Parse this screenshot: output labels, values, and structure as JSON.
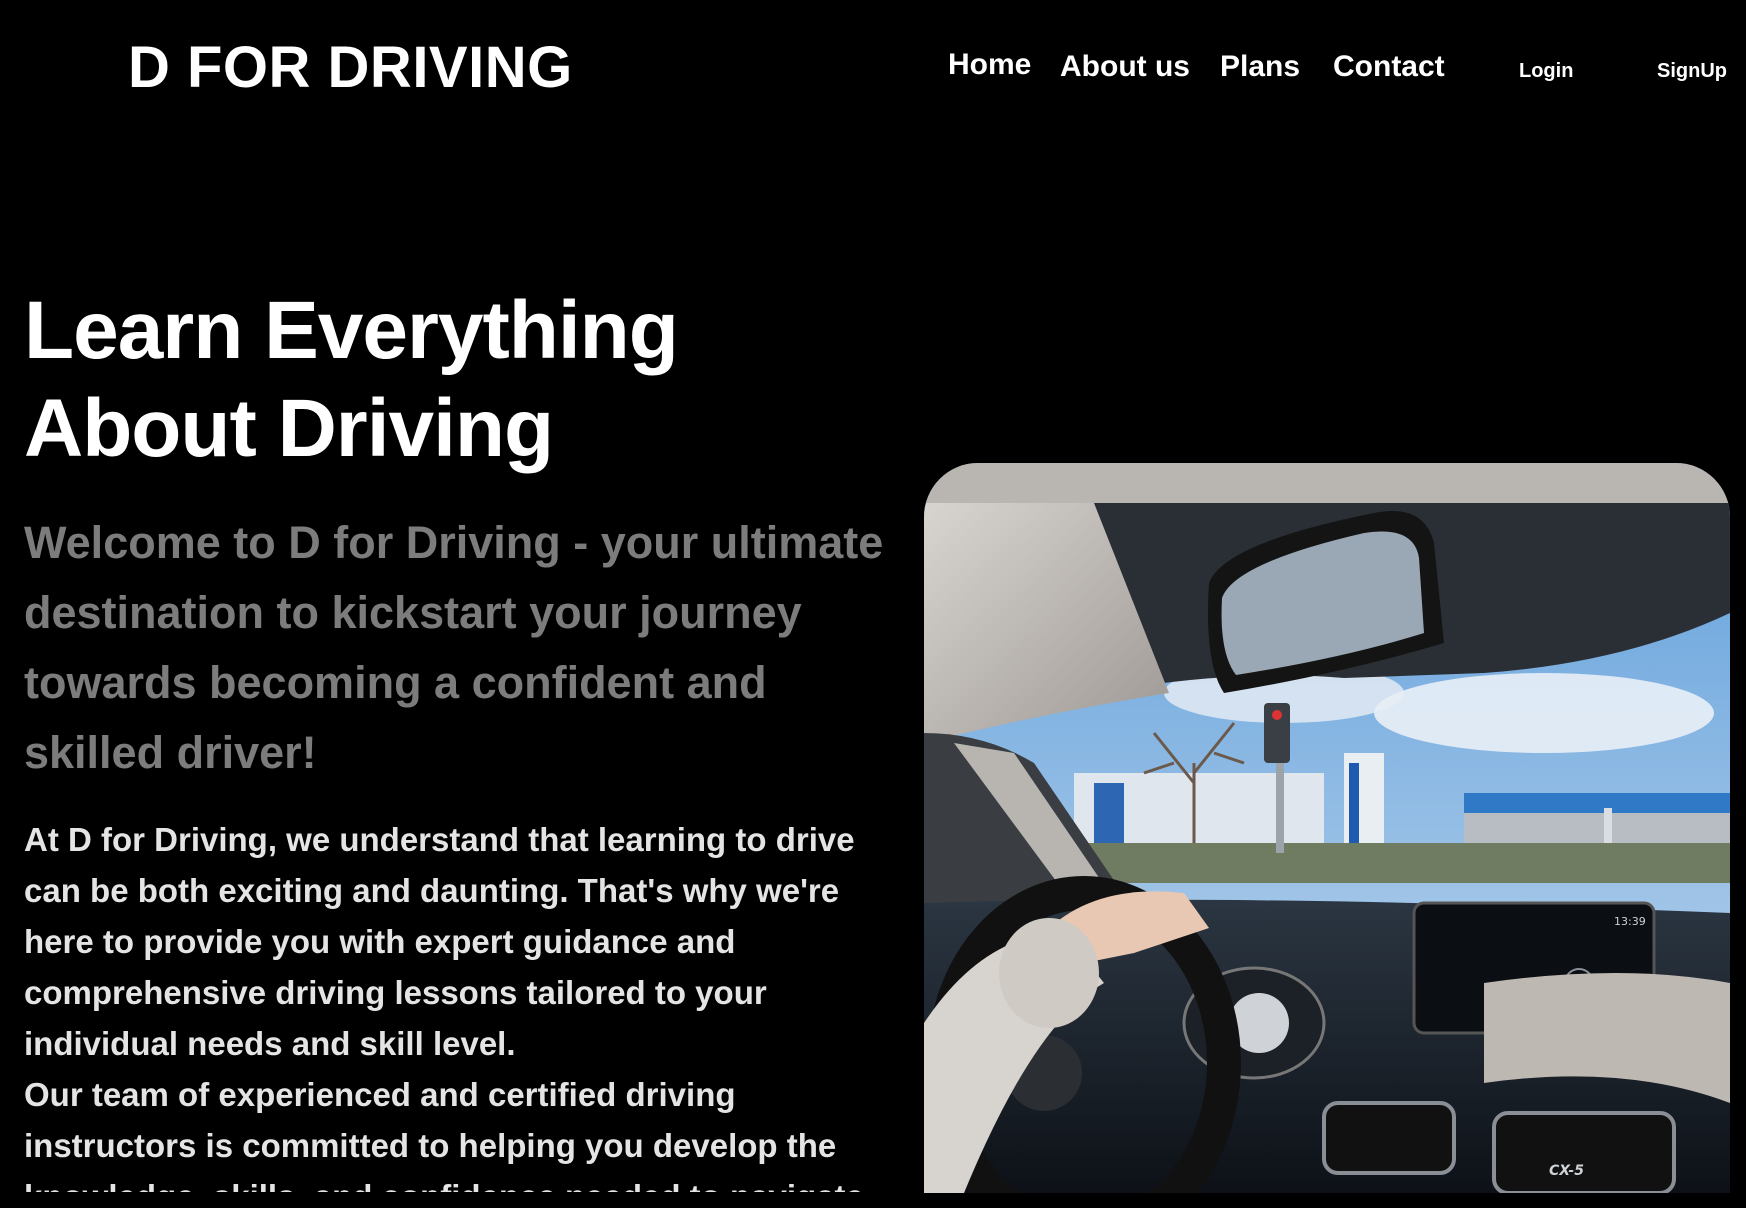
{
  "header": {
    "brand": "D FOR DRIVING",
    "nav": {
      "home": "Home",
      "about": "About us",
      "plans": "Plans",
      "contact": "Contact",
      "login": "Login",
      "signup": "SignUp"
    }
  },
  "hero": {
    "title_line1": "Learn Everything",
    "title_line2": "About Driving",
    "subtitle": "Welcome to D for Driving - your ultimate destination to kickstart your journey towards becoming a confident and skilled driver!",
    "paragraph1": "At D for Driving, we understand that learning to drive can be both exciting and daunting. That's why we're here to provide you with expert guidance and comprehensive driving lessons tailored to your individual needs and skill level.",
    "paragraph2": "Our team of experienced and certified driving instructors is committed to helping you develop the knowledge, skills, and confidence needed to navigate",
    "image": {
      "description_icon": "car-interior-photo",
      "dashboard_time": "13:39",
      "badge": "CX-5"
    }
  },
  "colors": {
    "background": "#000000",
    "text_primary": "#ffffff",
    "text_subtitle": "#7c7c7c",
    "text_body": "#e4e4e4"
  }
}
